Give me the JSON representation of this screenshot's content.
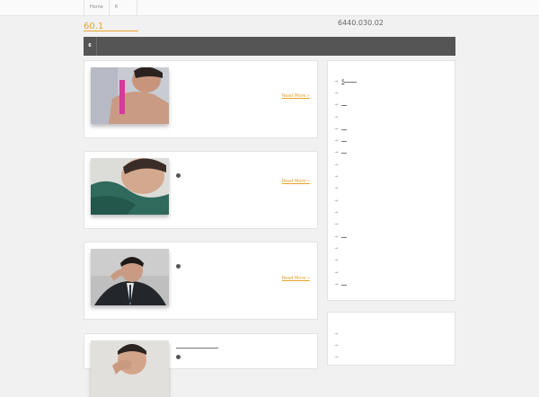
{
  "top_nav": {
    "items": [
      "Home",
      "6"
    ]
  },
  "header": {
    "site_title": "60.1",
    "code": "6440.030.02"
  },
  "main_nav": {
    "items": [
      "6"
    ]
  },
  "posts": [
    {
      "read_more": "Read More »",
      "bullet_text": ""
    },
    {
      "read_more": "Read More »",
      "bullet_text": ""
    },
    {
      "read_more": "Read More »",
      "bullet_text": ""
    },
    {
      "read_more": "",
      "bullet_text": ""
    }
  ],
  "sidebar": {
    "arrow": "→",
    "items": [
      "6",
      "",
      "",
      "",
      "",
      "",
      "",
      "",
      "",
      "",
      "",
      "",
      "",
      "",
      "",
      "",
      "",
      "",
      ""
    ],
    "items2": [
      "",
      "",
      ""
    ]
  }
}
